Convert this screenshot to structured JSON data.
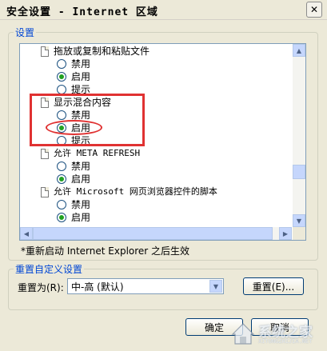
{
  "window": {
    "title": "安全设置 - Internet 区域",
    "close_glyph": "✕"
  },
  "settings_group": {
    "label": "设置",
    "items": [
      {
        "type": "category",
        "label": "拖放或复制和粘贴文件"
      },
      {
        "type": "option",
        "label": "禁用",
        "checked": false
      },
      {
        "type": "option",
        "label": "启用",
        "checked": true
      },
      {
        "type": "option",
        "label": "提示",
        "checked": false
      },
      {
        "type": "category",
        "label": "显示混合内容"
      },
      {
        "type": "option",
        "label": "禁用",
        "checked": false
      },
      {
        "type": "option",
        "label": "启用",
        "checked": true
      },
      {
        "type": "option",
        "label": "提示",
        "checked": false
      },
      {
        "type": "category",
        "label": "允许 META REFRESH"
      },
      {
        "type": "option",
        "label": "禁用",
        "checked": false
      },
      {
        "type": "option",
        "label": "启用",
        "checked": true
      },
      {
        "type": "category",
        "label": "允许 Microsoft 网页浏览器控件的脚本"
      },
      {
        "type": "option",
        "label": "禁用",
        "checked": false
      },
      {
        "type": "option",
        "label": "启用",
        "checked": true
      }
    ],
    "note": "*重新启动 Internet Explorer 之后生效"
  },
  "reset_group": {
    "label": "重置自定义设置",
    "reset_to_label": "重置为(R):",
    "selected_level": "中-高 (默认)",
    "reset_button": "重置(E)..."
  },
  "footer": {
    "ok_button": "确定",
    "cancel_button": "取消"
  },
  "watermark": {
    "main": "系统之家",
    "sub": "XITONGZHIJIA.NET"
  },
  "colors": {
    "highlight": "#e03232",
    "group_label": "#0046d5",
    "radio_dot": "#21a121"
  }
}
